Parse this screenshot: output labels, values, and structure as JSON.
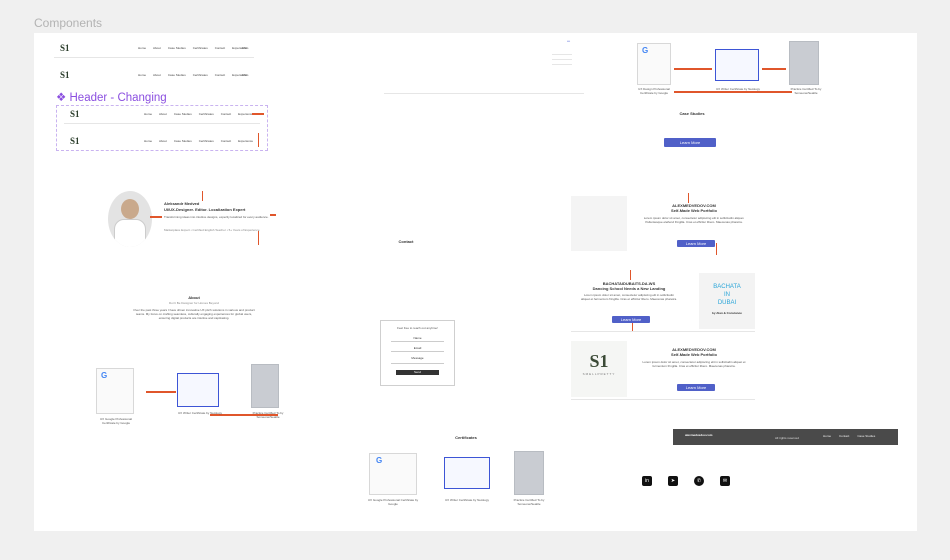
{
  "page": {
    "label": "Components"
  },
  "header": {
    "logo": "S1",
    "nav": [
      "Home",
      "About",
      "Case Studies",
      "Certificates",
      "Contact",
      "Experience"
    ],
    "lang": "ENG",
    "changing_title": "❖ Header - Changing"
  },
  "hero": {
    "name": "Aleksandr Medved",
    "title": "UI/UX-Designer. Editor. Localization Expert",
    "tagline": "Transforming ideas into intuitive designs, expertly localized for every audience.",
    "meta": "Marketplace Expert  •  Certified English Teacher  •  5+ Years of Experience"
  },
  "about": {
    "heading": "About",
    "sub": "Don't Be Designer for Homes Beyond",
    "body": "Over the past three years I have driven innovative UX pitch solutions in various and product teams. My focus on crafting seamless, culturally engaging experiences for global users, ensuring digital products are intuitive and captivating."
  },
  "contact": {
    "heading": "Contact",
    "intro": "Feel free to reach out anytime!",
    "fields": [
      "Name",
      "Email",
      "Message"
    ],
    "submit": "Send"
  },
  "certificates": {
    "heading": "Certificates",
    "items": [
      {
        "caption": "UX Google Professional Certificate by Google",
        "sub": "2024"
      },
      {
        "caption": "UX Writer Certificate by Netology",
        "sub": "2024"
      },
      {
        "caption": "Practice Certified To by Someone/Seattle",
        "sub": "2024"
      }
    ],
    "top_items": [
      {
        "caption": "UX Design Professional Certificate by Google"
      },
      {
        "caption": "UX Writer Certificate by Netology"
      },
      {
        "caption": "Practice Certified To by Someone/Seattle"
      }
    ]
  },
  "case_studies": {
    "heading": "Case Studies",
    "learn_more": "Learn More",
    "items": [
      {
        "title": "ALEXMEDVEDOV.COM",
        "sub": "Self-Made Web Portfolio",
        "body": "Lorem ipsum dolor sit amet, consectetur adipiscing elit in sollicitudin aliquet. Pellentesque eleifend fringilla. Cras et efficitur libero. Maecenas pharetra."
      },
      {
        "title": "BACHATAIDUBAITS.DA.WS",
        "sub": "Dancing School Needs a New Landing",
        "body": "Lorem ipsum dolor sit amet, consectetur adipiscing elit in sollicitudin aliquet et fermentum fringilla. Cras et efficitur libero. Maecenas pharetra."
      },
      {
        "title": "ALEXMEDVEDOV.COM",
        "sub": "Self-Made Web Portfolio",
        "body": "Lorem ipsum dolor sit amet, consectetur adipiscing elit in sollicitudin aliquet et fermentum fringilla. Cras et efficitur libero. Maecenas pharetra."
      }
    ],
    "bachata": {
      "line1": "BACHATA",
      "line2": "IN",
      "line3": "DUBAI",
      "by": "by Alan & Constance"
    },
    "smellpretty": "SMELLPRETTY"
  },
  "footer": {
    "brand": "alexmedvedov.com",
    "sub": "All rights reserved",
    "links": [
      "Home",
      "Contact",
      "Case Studies"
    ]
  },
  "social": [
    "in",
    "➤",
    "✆",
    "✉"
  ],
  "colors": {
    "accent": "#5060c8",
    "orange": "#e0562b",
    "purple": "#8b4fe0",
    "footer": "#4a4a4a"
  }
}
